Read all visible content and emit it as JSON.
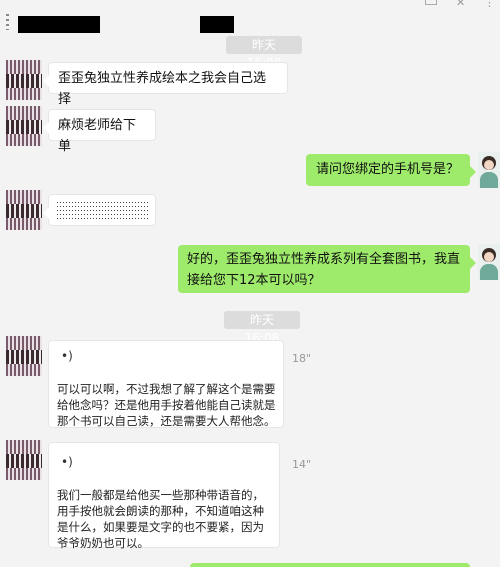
{
  "header": {
    "icons": [
      "dots-icon",
      "pin-icon",
      "close-icon"
    ]
  },
  "timestamps": {
    "first": "昨天 16:08",
    "second": "昨天 16:08"
  },
  "messages": {
    "m1": "歪歪兔独立性养成绘本之我会自己选择",
    "m2": "麻烦老师给下单",
    "m3": "请问您绑定的手机号是？",
    "m4": "好的，歪歪兔独立性养成系列有全套图书，我直接给您下12本可以吗？",
    "voice1": {
      "duration": "18\"",
      "transcript": "可以可以啊，不过我想了解了解这个是需要给他念吗？还是他用手按着他能自己读就是那个书可以自己读，还是需要大人帮他念。"
    },
    "voice2": {
      "duration": "14\"",
      "transcript": "我们一般都是给他买一些那种带语音的，用手按他就会朗读的那种，不知道咱这种是什么，如果要是文字的也不要紧，因为爷爷奶奶也可以。"
    }
  },
  "colors": {
    "outgoing": "#9eea6a",
    "incoming": "#ffffff",
    "background": "#f3f3f3"
  }
}
